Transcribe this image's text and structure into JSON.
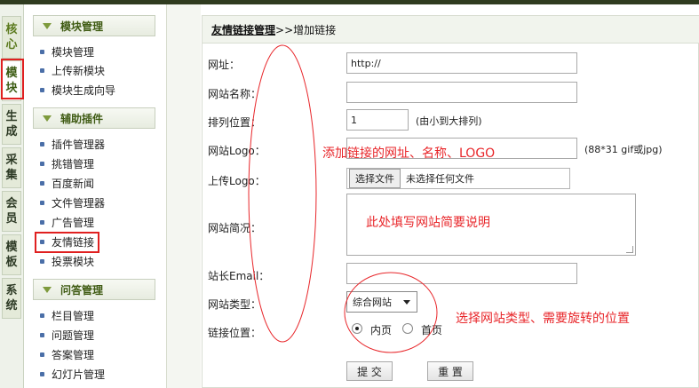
{
  "nav_tabs": [
    {
      "label": "核\n心"
    },
    {
      "label": "模\n块"
    },
    {
      "label": "生\n成"
    },
    {
      "label": "采\n集"
    },
    {
      "label": "会\n员"
    },
    {
      "label": "模\n板"
    },
    {
      "label": "系\n统"
    }
  ],
  "menu": {
    "sections": [
      {
        "title": "模块管理",
        "items": [
          "模块管理",
          "上传新模块",
          "模块生成向导"
        ]
      },
      {
        "title": "辅助插件",
        "items": [
          "插件管理器",
          "挑错管理",
          "百度新闻",
          "文件管理器",
          "广告管理",
          "友情链接",
          "投票模块"
        ]
      },
      {
        "title": "问答管理",
        "items": [
          "栏目管理",
          "问题管理",
          "答案管理",
          "幻灯片管理"
        ]
      }
    ]
  },
  "breadcrumb": {
    "link": "友情链接管理",
    "rest": ">>增加链接"
  },
  "form": {
    "url_label": "网址：",
    "url_value": "http://",
    "sitename_label": "网站名称：",
    "sitename_value": "",
    "order_label": "排列位置：",
    "order_value": "1",
    "order_hint": "(由小到大排列)",
    "logo_label": "网站Logo：",
    "logo_value": "",
    "logo_hint": "(88*31 gif或jpg)",
    "upload_label": "上传Logo：",
    "upload_button": "选择文件",
    "upload_status": "未选择任何文件",
    "desc_label": "网站简况：",
    "email_label": "站长Email：",
    "email_value": "",
    "type_label": "网站类型：",
    "type_selected": "综合网站",
    "position_label": "链接位置：",
    "position_option_1": "内页",
    "position_option_2": "首页",
    "submit": "提 交",
    "reset": "重 置"
  },
  "annotations": {
    "fields_note": "添加链接的网址、名称、LOGO",
    "desc_note": "此处填写网站简要说明",
    "type_note": "选择网站类型、需要旋转的位置"
  },
  "colors": {
    "annotation": "#e8262a",
    "menu_title": "#3e5a12",
    "bullet": "#4b6fa8"
  }
}
